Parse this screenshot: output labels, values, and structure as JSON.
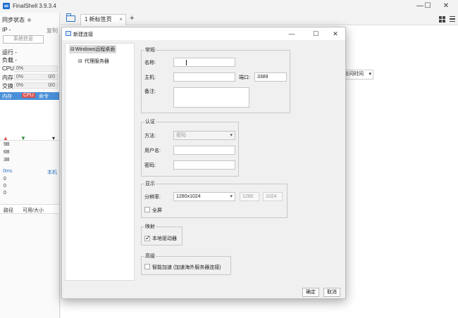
{
  "app": {
    "title": "FinalShell 3.9.3.4"
  },
  "window_controls": {
    "minimize": "—",
    "maximize": "☐",
    "close": "✕"
  },
  "left_panel": {
    "sync_status": "同步状态",
    "ip_label": "IP -",
    "copy": "复制",
    "sysinfo_button": "系统信息",
    "running": "运行 -",
    "load": "负载 -",
    "stats": [
      {
        "label": "CPU",
        "value": "0%",
        "extra": ""
      },
      {
        "label": "内存",
        "value": "0%",
        "extra": "0/0"
      },
      {
        "label": "交换",
        "value": "0%",
        "extra": "0/0"
      }
    ],
    "tabs": [
      "内存",
      "CPU",
      "命令"
    ],
    "net_values": [
      "9B",
      "6B",
      "3B"
    ],
    "ping_label": "0ms",
    "ping_host": "本机",
    "ping_values": [
      "0",
      "0",
      "0"
    ],
    "footer": {
      "path": "路径",
      "usage": "可用/大小"
    }
  },
  "main": {
    "tab": {
      "label": "1 新标签页",
      "close": "×"
    },
    "add_tab": "+",
    "sort_select": "访问时间"
  },
  "dialog": {
    "title": "新建连接",
    "tree": {
      "root": "Windows远程桌面",
      "child": "代理服务器",
      "expander": "⊟"
    },
    "general": {
      "title": "常规",
      "name_label": "名称:",
      "name_value": "",
      "host_label": "主机:",
      "host_value": "",
      "port_label": "端口:",
      "port_value": "3389",
      "note_label": "备注:",
      "note_value": ""
    },
    "auth": {
      "title": "认证",
      "method_label": "方法:",
      "method_value": "密码",
      "user_label": "用户名:",
      "user_value": "",
      "password_label": "密码:",
      "password_value": ""
    },
    "display": {
      "title": "显示",
      "resolution_label": "分辨率:",
      "resolution_value": "1280x1024",
      "width_value": "1280",
      "height_value": "1024",
      "fullscreen_label": "全屏",
      "fullscreen_checked": false
    },
    "mapping": {
      "title": "映射",
      "local_drive_label": "本地驱动器",
      "local_drive_checked": true
    },
    "advanced": {
      "title": "高级",
      "smart_accel_label": "智能加速 (加速海外服务器连接)",
      "smart_accel_checked": false
    },
    "ok_button": "确定",
    "cancel_button": "取消"
  },
  "colors": {
    "accent": "#4a90d9",
    "active_tab": "#d9534f",
    "folder": "#2b74c9"
  }
}
